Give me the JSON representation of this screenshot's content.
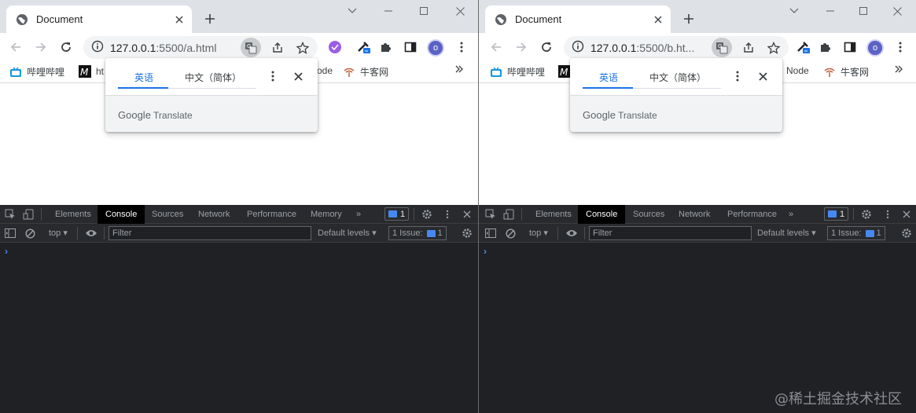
{
  "windows": [
    {
      "tab_title": "Document",
      "url_host": "127.0.0.1",
      "url_path": ":5500/a.html",
      "avatar_letter": "o",
      "bookmarks": [
        {
          "icon": "bilibili-icon",
          "label": "哔哩哔哩"
        },
        {
          "icon": "m-icon",
          "label": "ht"
        },
        {
          "icon": "node-icon",
          "label": "ode"
        },
        {
          "icon": "nowcoder-icon",
          "label": "牛客网"
        }
      ],
      "translate": {
        "tab_en": "英语",
        "tab_zh": "中文（简体）",
        "footer_brand": "Google",
        "footer_product": "Translate"
      },
      "devtools": {
        "tabs": [
          "Elements",
          "Console",
          "Sources",
          "Network",
          "Performance",
          "Memory"
        ],
        "selected_tab": "Console",
        "issues_badge": "1",
        "context": "top",
        "filter_placeholder": "Filter",
        "levels": "Default levels",
        "issue_label": "1 Issue:",
        "issue_count": "1",
        "prompt": "›"
      }
    },
    {
      "tab_title": "Document",
      "url_host": "127.0.0.1",
      "url_path": ":5500/b.ht...",
      "avatar_letter": "o",
      "bookmarks": [
        {
          "icon": "bilibili-icon",
          "label": "哔哩哔哩"
        },
        {
          "icon": "m-icon",
          "label": ""
        },
        {
          "icon": "node-icon",
          "label": "Node"
        },
        {
          "icon": "nowcoder-icon",
          "label": "牛客网"
        }
      ],
      "translate": {
        "tab_en": "英语",
        "tab_zh": "中文（简体）",
        "footer_brand": "Google",
        "footer_product": "Translate"
      },
      "devtools": {
        "tabs": [
          "Elements",
          "Console",
          "Sources",
          "Network",
          "Performance"
        ],
        "selected_tab": "Console",
        "issues_badge": "1",
        "context": "top",
        "filter_placeholder": "Filter",
        "levels": "Default levels",
        "issue_label": "1 Issue:",
        "issue_count": "1",
        "prompt": "›"
      }
    }
  ],
  "watermark": "@稀土掘金技术社区",
  "colors": {
    "tabstrip": "#dee1e6",
    "accent": "#1a73e8",
    "devtools_bg": "#202124",
    "avatar": "#5b62c4"
  }
}
